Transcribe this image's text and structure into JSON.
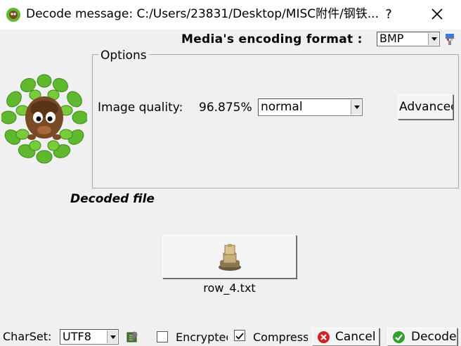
{
  "window": {
    "title": "Decode message: C:/Users/23831/Desktop/MISC附件/钢铁...",
    "help_label": "?"
  },
  "media": {
    "label": "Media's encoding format :",
    "format": "BMP"
  },
  "options": {
    "legend": "Options",
    "quality_label": "Image quality:",
    "quality_value": "96.875%",
    "quality_mode": "normal",
    "advanced_label": "Advanced"
  },
  "decoded": {
    "label": "Decoded file",
    "file_name": "row_4.txt"
  },
  "footer": {
    "charset_label": "CharSet:",
    "charset_value": "UTF8",
    "encrypted_label": "Encrypted",
    "encrypted_checked": false,
    "compress_label": "Compress",
    "compress_checked": true,
    "cancel_label": "Cancel",
    "decode_label": "Decode"
  },
  "colors": {
    "cancel_icon": "#d42020",
    "decode_icon": "#2fa02f",
    "leaf_green": "#5fb82e"
  }
}
